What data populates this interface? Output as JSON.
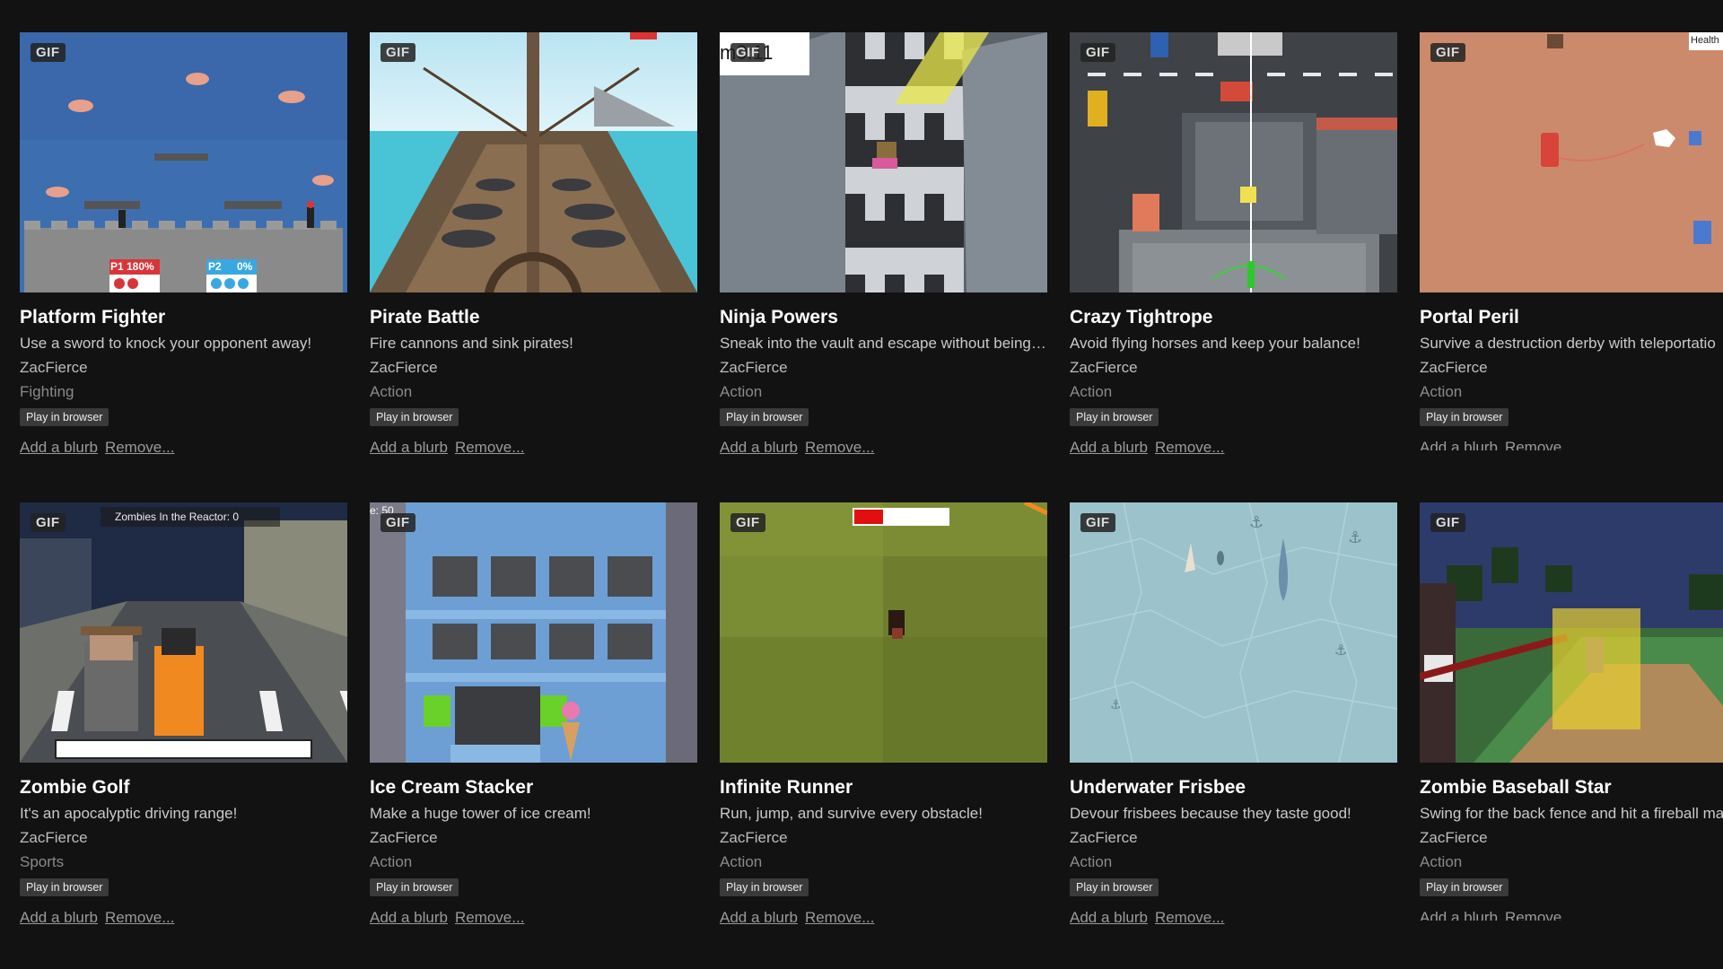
{
  "games": [
    {
      "title": "Platform Fighter",
      "description": "Use a sword to knock your opponent away!",
      "author": "ZacFierce",
      "genre": "Fighting",
      "platform": "Play in browser",
      "badge": "GIF",
      "add_blurb": "Add a blurb",
      "remove": "Remove...",
      "overlay": {
        "p1": "P1 180%",
        "p2": "P2",
        "p2_pct": "0%"
      }
    },
    {
      "title": "Pirate Battle",
      "description": "Fire cannons and sink pirates!",
      "author": "ZacFierce",
      "genre": "Action",
      "platform": "Play in browser",
      "badge": "GIF",
      "add_blurb": "Add a blurb",
      "remove": "Remove..."
    },
    {
      "title": "Ninja Powers",
      "description": "Sneak into the vault and escape without being ...",
      "author": "ZacFierce",
      "genre": "Action",
      "platform": "Play in browser",
      "badge": "GIF",
      "add_blurb": "Add a blurb",
      "remove": "Remove...",
      "overlay": {
        "timer": "m0:11"
      }
    },
    {
      "title": "Crazy Tightrope",
      "description": "Avoid flying horses and keep your balance!",
      "author": "ZacFierce",
      "genre": "Action",
      "platform": "Play in browser",
      "badge": "GIF",
      "add_blurb": "Add a blurb",
      "remove": "Remove..."
    },
    {
      "title": "Portal Peril",
      "description": "Survive a destruction derby with teleportatio",
      "author": "ZacFierce",
      "genre": "Action",
      "platform": "Play in browser",
      "badge": "GIF",
      "add_blurb": "Add a blurb",
      "remove": "Remove...",
      "overlay": {
        "health": "Health"
      }
    },
    {
      "title": "Zombie Golf",
      "description": "It's an apocalyptic driving range!",
      "author": "ZacFierce",
      "genre": "Sports",
      "platform": "Play in browser",
      "badge": "GIF",
      "add_blurb": "Add a blurb",
      "remove": "Remove...",
      "overlay": {
        "zombies": "Zombies In the Reactor: 0"
      }
    },
    {
      "title": "Ice Cream Stacker",
      "description": "Make a huge tower of ice cream!",
      "author": "ZacFierce",
      "genre": "Action",
      "platform": "Play in browser",
      "badge": "GIF",
      "add_blurb": "Add a blurb",
      "remove": "Remove...",
      "overlay": {
        "score": "e: 50"
      }
    },
    {
      "title": "Infinite Runner",
      "description": "Run, jump, and survive every obstacle!",
      "author": "ZacFierce",
      "genre": "Action",
      "platform": "Play in browser",
      "badge": "GIF",
      "add_blurb": "Add a blurb",
      "remove": "Remove..."
    },
    {
      "title": "Underwater Frisbee",
      "description": "Devour frisbees because they taste good!",
      "author": "ZacFierce",
      "genre": "Action",
      "platform": "Play in browser",
      "badge": "GIF",
      "add_blurb": "Add a blurb",
      "remove": "Remove..."
    },
    {
      "title": "Zombie Baseball Star",
      "description": "Swing for the back fence and hit a fireball ma",
      "author": "ZacFierce",
      "genre": "Action",
      "platform": "Play in browser",
      "badge": "GIF",
      "add_blurb": "Add a blurb",
      "remove": "Remove..."
    }
  ],
  "colors": {
    "background": "#121212",
    "title": "#ffffff",
    "description": "#c9c9c9",
    "genre": "#8a8a8a",
    "tag_bg": "#3a3a3a"
  }
}
